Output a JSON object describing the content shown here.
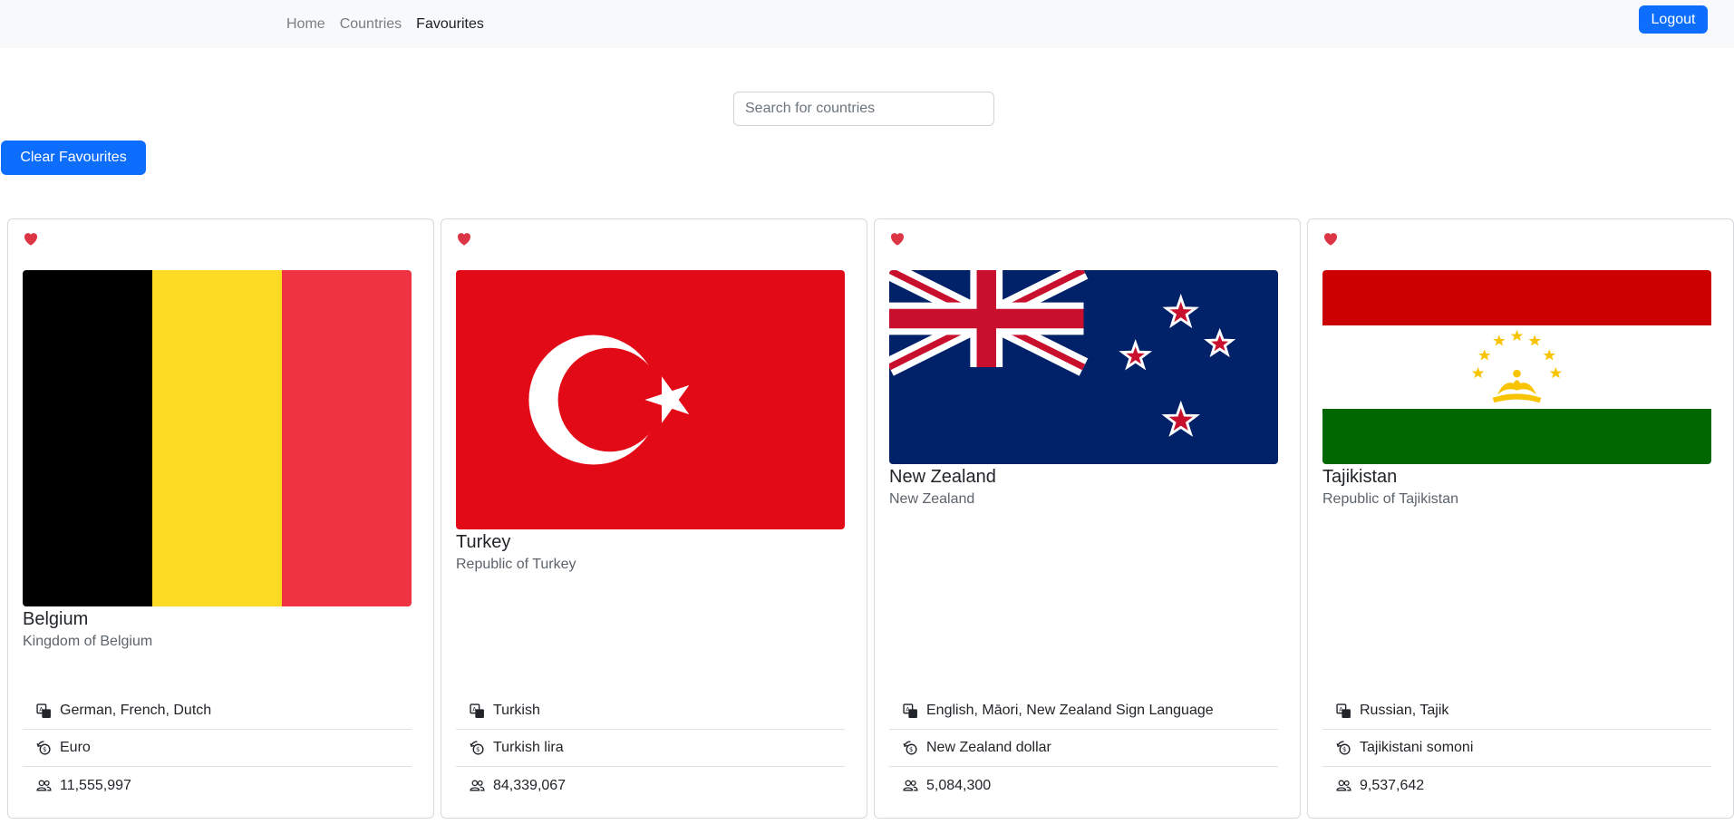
{
  "nav": {
    "items": [
      {
        "label": "Home",
        "active": false
      },
      {
        "label": "Countries",
        "active": false
      },
      {
        "label": "Favourites",
        "active": true
      }
    ],
    "logout_label": "Logout"
  },
  "search": {
    "placeholder": "Search for countries",
    "value": ""
  },
  "clear_button_label": "Clear Favourites",
  "colors": {
    "primary": "#0d6efd",
    "heart": "#dc3545",
    "navbar": "#f8f9fa"
  },
  "icons": {
    "favourite": "heart-icon",
    "languages": "translate-icon",
    "currency": "currency-exchange-icon",
    "population": "people-icon"
  },
  "cards": [
    {
      "name": "Belgium",
      "official_name": "Kingdom of Belgium",
      "flag": "flag-belgium",
      "languages": "German, French, Dutch",
      "currency": "Euro",
      "population": "11,555,997"
    },
    {
      "name": "Turkey",
      "official_name": "Republic of Turkey",
      "flag": "flag-turkey",
      "languages": "Turkish",
      "currency": "Turkish lira",
      "population": "84,339,067"
    },
    {
      "name": "New Zealand",
      "official_name": "New Zealand",
      "flag": "flag-new-zealand",
      "languages": "English, Māori, New Zealand Sign Language",
      "currency": "New Zealand dollar",
      "population": "5,084,300"
    },
    {
      "name": "Tajikistan",
      "official_name": "Republic of Tajikistan",
      "flag": "flag-tajikistan",
      "languages": "Russian, Tajik",
      "currency": "Tajikistani somoni",
      "population": "9,537,642"
    }
  ]
}
